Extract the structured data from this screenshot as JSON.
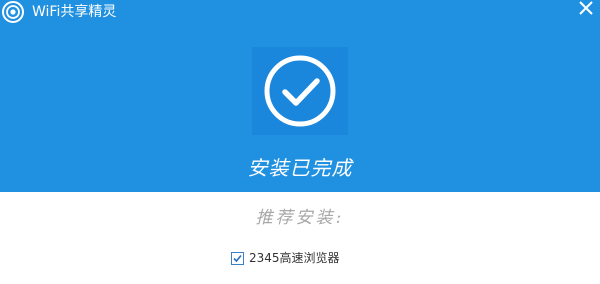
{
  "window": {
    "title": "WiFi共享精灵",
    "logo_icon": "wifi-logo-icon",
    "close_icon": "close-icon"
  },
  "main": {
    "status_icon": "checkmark-circle-icon",
    "status_text": "安装已完成"
  },
  "recommend": {
    "title": "推荐安装:",
    "options": [
      {
        "label": "2345高速浏览器",
        "checked": true
      }
    ]
  },
  "colors": {
    "header_bg": "#2090e0",
    "icon_bg": "#1a86dc",
    "recommend_text": "#a8a8a8"
  }
}
